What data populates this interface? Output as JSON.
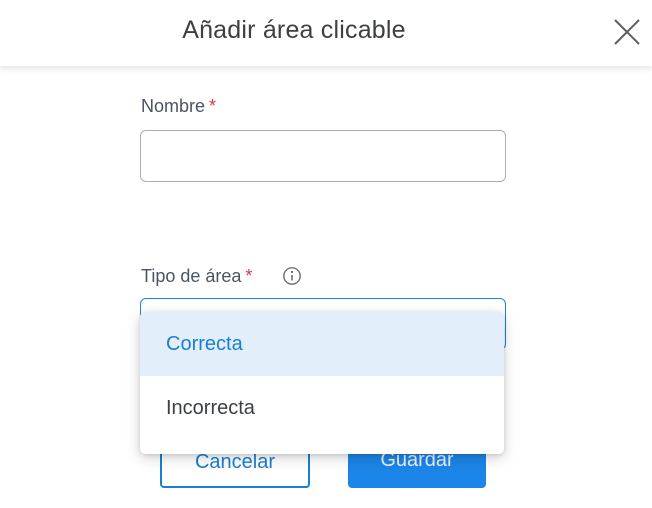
{
  "header": {
    "title": "Añadir área clicable"
  },
  "form": {
    "name_field": {
      "label": "Nombre",
      "required_mark": "*",
      "value": ""
    },
    "area_type_field": {
      "label": "Tipo de área",
      "required_mark": "*",
      "options": [
        {
          "label": "Correcta",
          "selected": true
        },
        {
          "label": "Incorrecta",
          "selected": false
        }
      ]
    }
  },
  "actions": {
    "cancel_label": "Cancelar",
    "save_label": "Guardar"
  },
  "colors": {
    "accent": "#1a86e6",
    "required": "#e2363b",
    "selected_option_bg": "#e3eefb"
  },
  "icons": [
    "close-icon",
    "info-icon"
  ]
}
